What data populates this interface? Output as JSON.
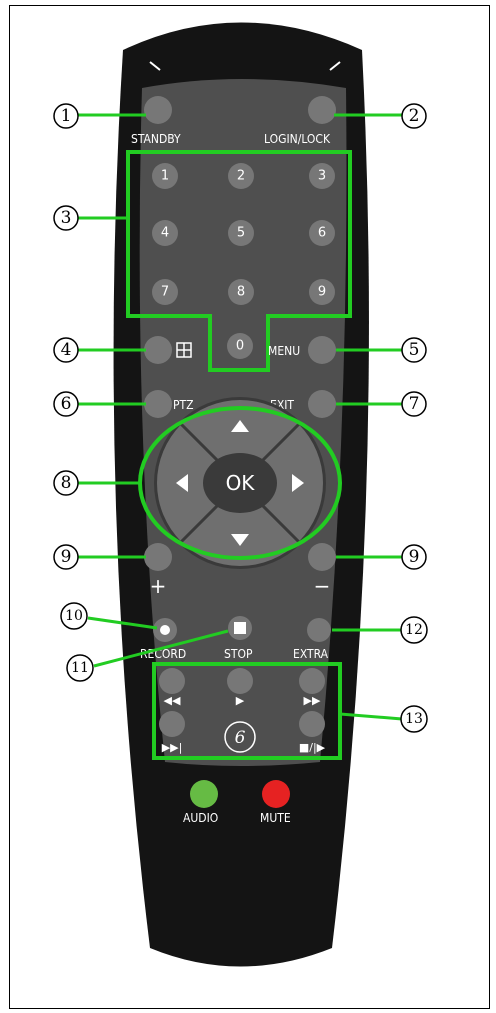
{
  "labels": {
    "standby": "STANDBY",
    "login_lock": "LOGIN/LOCK",
    "menu": "MENU",
    "ptz": "PTZ",
    "exit": "EXIT",
    "ok": "OK",
    "plus": "+",
    "minus": "−",
    "record": "RECORD",
    "stop": "STOP",
    "extra": "EXTRA",
    "audio": "AUDIO",
    "mute": "MUTE",
    "six_circle": "6"
  },
  "keys": [
    "1",
    "2",
    "3",
    "4",
    "5",
    "6",
    "7",
    "8",
    "9",
    "0"
  ],
  "callouts": [
    "1",
    "2",
    "3",
    "4",
    "5",
    "6",
    "7",
    "8",
    "9",
    "9",
    "10",
    "11",
    "12",
    "13"
  ],
  "colors": {
    "body": "#141414",
    "panel": "#4f4f4f",
    "button": "#777777",
    "highlight": "#22cc22",
    "audio": "#66bb44",
    "mute": "#e62222"
  }
}
